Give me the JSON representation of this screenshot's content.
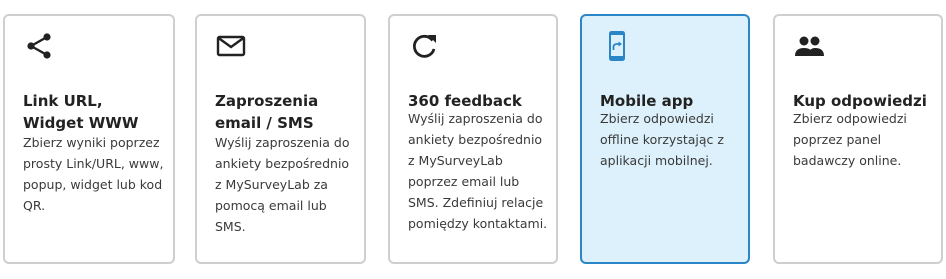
{
  "cards": [
    {
      "icon": "share-icon",
      "title": "Link URL, Widget WWW",
      "desc": "Zbierz wyniki poprzez prosty Link/URL, www, popup, widget lub kod QR."
    },
    {
      "icon": "email-icon",
      "title": "Zaproszenia email / SMS",
      "desc": "Wyślij zaproszenia do ankiety bezpośrednio z MySurveyLab za pomocą email lub SMS."
    },
    {
      "icon": "refresh-icon",
      "title": "360 feedback",
      "desc": "Wyślij zaproszenia do ankiety bezpośrednio z MySurveyLab poprzez email lub SMS. Zdefiniuj relacje pomiędzy kontaktami."
    },
    {
      "icon": "mobile-phone-icon",
      "title": "Mobile app",
      "desc": "Zbierz odpowiedzi offline korzystając z aplikacji mobilnej.",
      "selected": true
    },
    {
      "icon": "people-icon",
      "title": "Kup odpowiedzi",
      "desc": "Zbierz odpowiedzi poprzez panel badawczy online."
    }
  ],
  "colors": {
    "border": "#cfcfcf",
    "selected_border": "#2a86c6",
    "selected_background": "#dcf1fb",
    "mobile_icon": "#2a86c6",
    "icon": "#222222"
  }
}
